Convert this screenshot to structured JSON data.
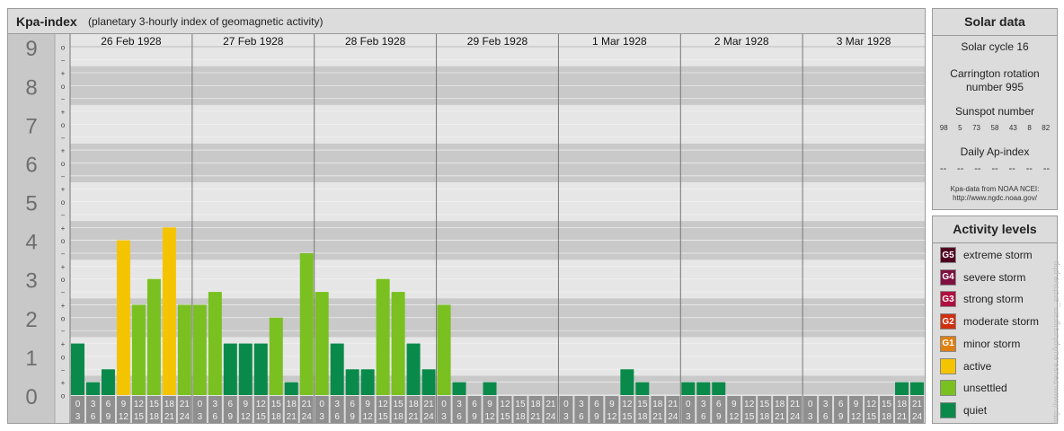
{
  "header": {
    "title": "Kpa-index",
    "subtitle": "(planetary 3-hourly index of geomagnetic activity)"
  },
  "colors": {
    "quiet": "#0a8a4a",
    "unsettled": "#7ac020",
    "active": "#f5c400",
    "minor_storm": "#e08010",
    "moderate_storm": "#d03010",
    "strong_storm": "#b01040",
    "severe_storm": "#801040",
    "extreme_storm": "#500020"
  },
  "chart_data": {
    "type": "bar",
    "y_ticks": [
      "0",
      "1",
      "2",
      "3",
      "4",
      "5",
      "6",
      "7",
      "8",
      "9"
    ],
    "sub_ticks": [
      "o",
      "+",
      "−",
      "o",
      "+",
      "−",
      "o",
      "+",
      "−",
      "o",
      "+",
      "−",
      "o",
      "+",
      "−",
      "o",
      "+",
      "−",
      "o",
      "+",
      "−",
      "o",
      "+",
      "−",
      "o",
      "+",
      "−",
      "o"
    ],
    "ylim": [
      0,
      9.33
    ],
    "days": [
      "26 Feb 1928",
      "27 Feb 1928",
      "28 Feb 1928",
      "29 Feb 1928",
      "1 Mar 1928",
      "2 Mar 1928",
      "3 Mar 1928"
    ],
    "interval_start": [
      "0",
      "3",
      "6",
      "9",
      "12",
      "15",
      "18",
      "21"
    ],
    "interval_end": [
      "3",
      "6",
      "9",
      "12",
      "15",
      "18",
      "21",
      "24"
    ],
    "values": [
      1.333,
      0.333,
      0.667,
      4.0,
      2.333,
      3.0,
      4.333,
      2.333,
      2.333,
      2.667,
      1.333,
      1.333,
      1.333,
      2.0,
      0.333,
      3.667,
      2.667,
      1.333,
      0.667,
      0.667,
      3.0,
      2.667,
      1.333,
      0.667,
      2.333,
      0.333,
      0.0,
      0.333,
      0.0,
      0.0,
      0.0,
      0.0,
      0.0,
      0.0,
      0.0,
      0.0,
      0.667,
      0.333,
      0.0,
      0.0,
      0.333,
      0.333,
      0.333,
      0.0,
      0.0,
      0.0,
      0.0,
      0.0,
      0.0,
      0.0,
      0.0,
      0.0,
      0.0,
      0.0,
      0.333,
      0.333
    ]
  },
  "solar": {
    "title": "Solar data",
    "cycle": "Solar cycle 16",
    "carrington_line1": "Carrington rotation",
    "carrington_line2": "number 995",
    "sunspot_label": "Sunspot number",
    "sunspots": [
      "98",
      "5",
      "73",
      "58",
      "43",
      "8",
      "82"
    ],
    "ap_label": "Daily Ap-index",
    "ap_values": [
      "--",
      "--",
      "--",
      "--",
      "--",
      "--",
      "--"
    ],
    "credit_line1": "Kpa-data from NOAA NCEI:",
    "credit_line2": "http://www.ngdc.noaa.gov/"
  },
  "legend": {
    "title": "Activity levels",
    "items": [
      {
        "badge": "G5",
        "label": "extreme storm",
        "color": "#500020"
      },
      {
        "badge": "G4",
        "label": "severe storm",
        "color": "#801040"
      },
      {
        "badge": "G3",
        "label": "strong storm",
        "color": "#b01040"
      },
      {
        "badge": "G2",
        "label": "moderate storm",
        "color": "#d03010"
      },
      {
        "badge": "G1",
        "label": "minor storm",
        "color": "#e08010"
      },
      {
        "badge": "",
        "label": "active",
        "color": "#f5c400"
      },
      {
        "badge": "",
        "label": "unsettled",
        "color": "#7ac020"
      },
      {
        "badge": "",
        "label": "quiet",
        "color": "#0a8a4a"
      }
    ]
  },
  "watermark": "http://www.tieuse.eu/kp/ursigram_archive.php"
}
